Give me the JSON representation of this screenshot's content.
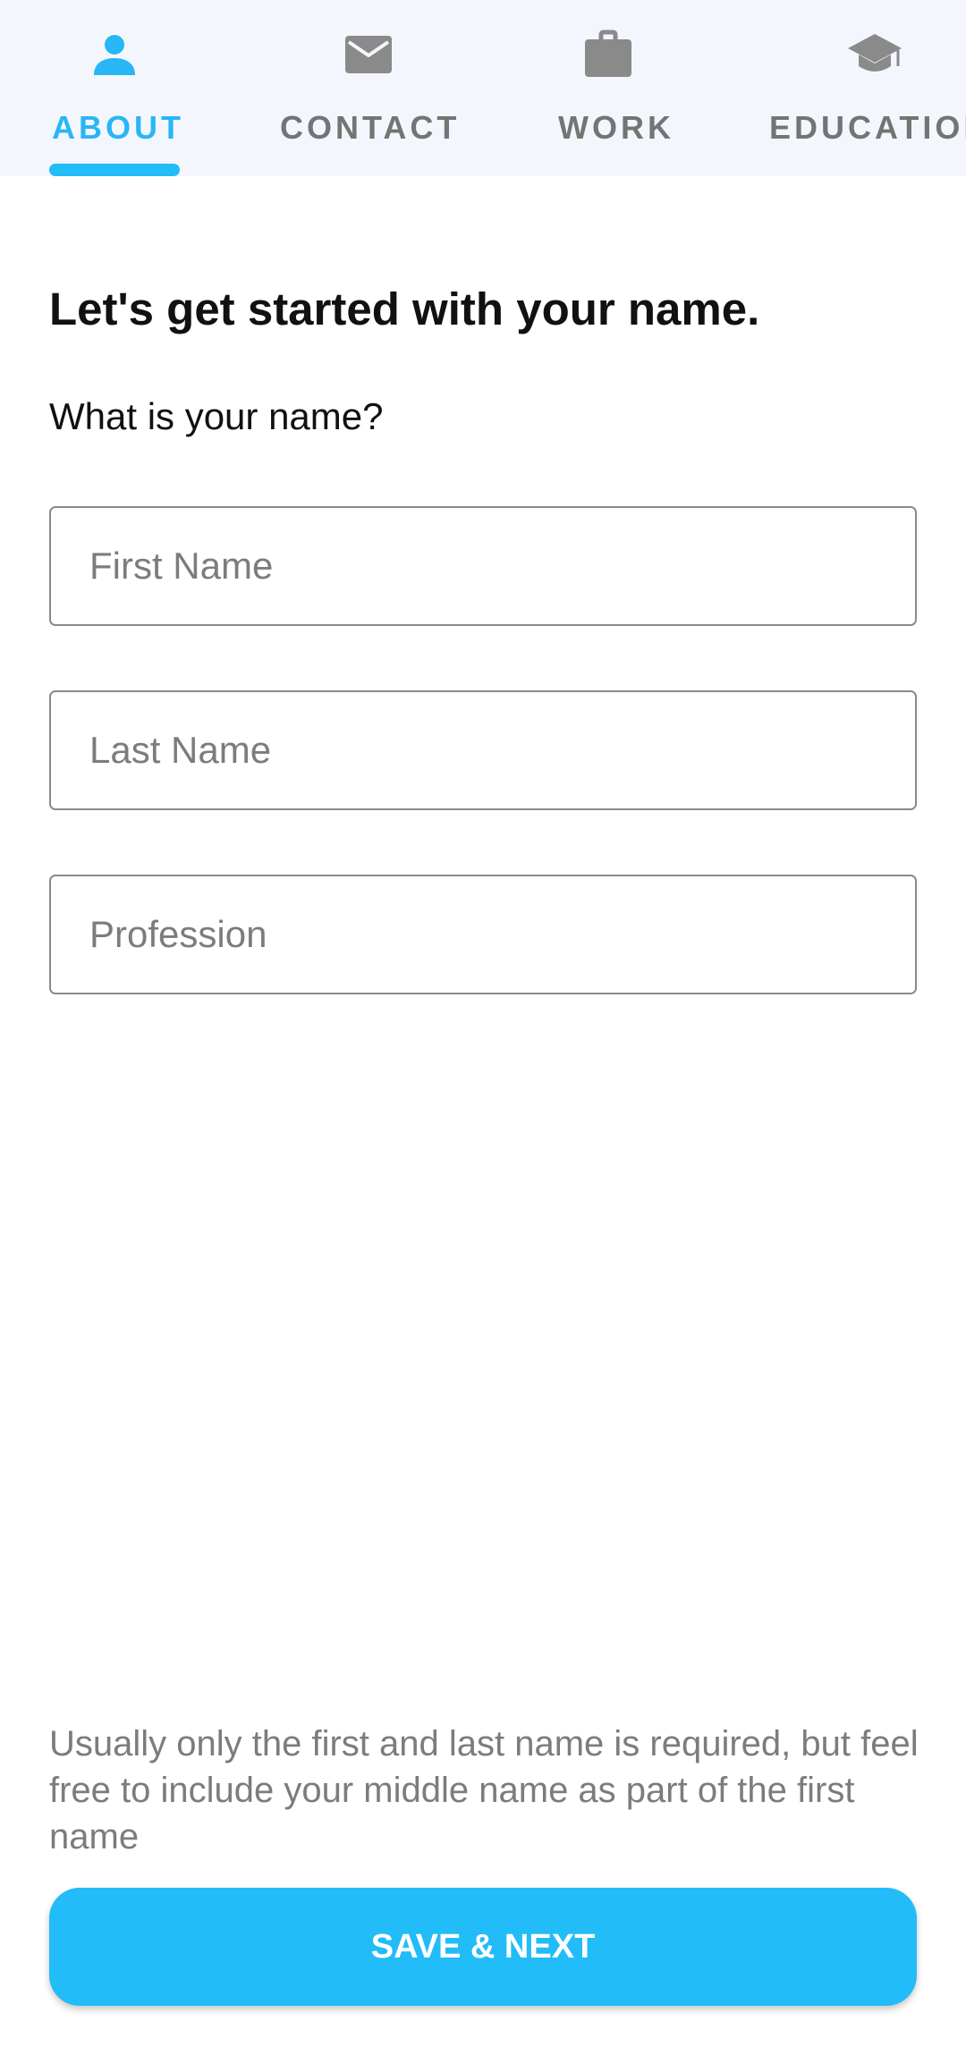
{
  "colors": {
    "accent": "#22bcf8",
    "active_tab_text": "#29b6f6",
    "inactive_tab": "#747474",
    "tabbar_background": "#f3f7fd"
  },
  "tabs": [
    {
      "label": "ABOUT",
      "icon": "person-icon",
      "active": true
    },
    {
      "label": "CONTACT",
      "icon": "mail-icon",
      "active": false
    },
    {
      "label": "WORK",
      "icon": "briefcase-icon",
      "active": false
    },
    {
      "label": "EDUCATION",
      "icon": "graduation-cap-icon",
      "active": false
    }
  ],
  "form": {
    "heading": "Let's get started with your name.",
    "question": "What is your name?",
    "first_name": {
      "value": "",
      "placeholder": "First Name"
    },
    "last_name": {
      "value": "",
      "placeholder": "Last Name"
    },
    "profession": {
      "value": "",
      "placeholder": "Profession"
    }
  },
  "footer": {
    "hint": "Usually only the first and last name is required, but feel free to include your middle name as part of the first name",
    "save_button_label": "SAVE & NEXT"
  }
}
